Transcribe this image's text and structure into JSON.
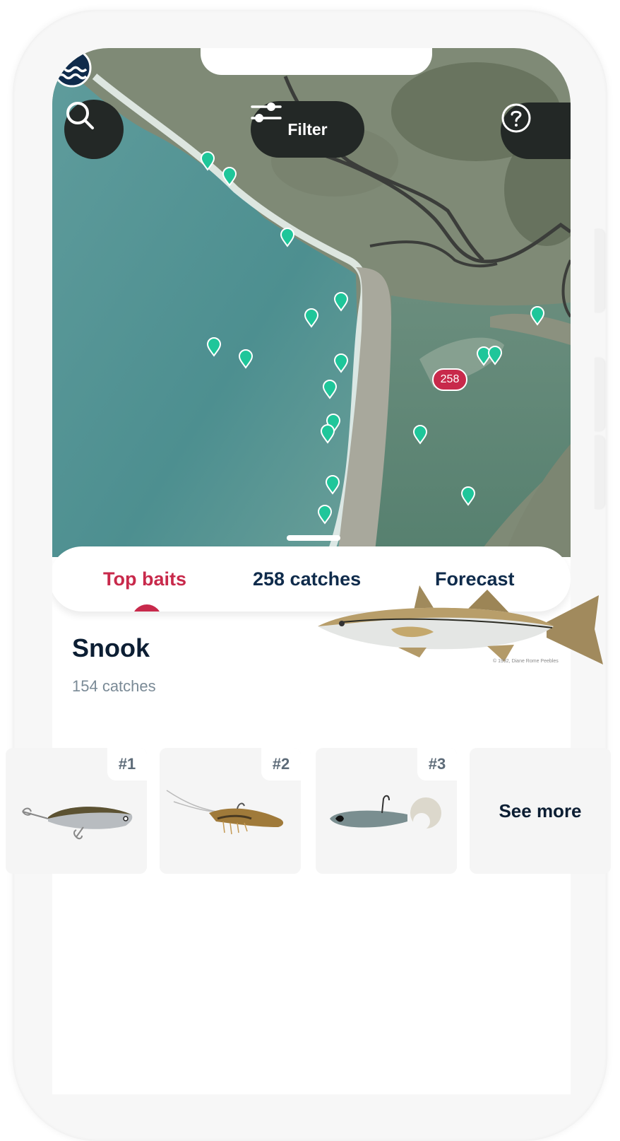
{
  "map": {
    "search_button_icon": "search-icon",
    "filter_button": {
      "label": "Filter",
      "icon": "sliders-icon"
    },
    "help_button_icon": "help-circle-icon",
    "cluster": {
      "icon": "water-waves-icon",
      "count": "258"
    },
    "pin_color": "#1fc69a"
  },
  "tabs": [
    {
      "label": "Top baits",
      "active": true
    },
    {
      "label": "258 catches",
      "active": false
    },
    {
      "label": "Forecast",
      "active": false
    }
  ],
  "species": {
    "name": "Snook",
    "catches": "154 catches",
    "image_credit": "© 1992, Diane Rome Peebles"
  },
  "baits": [
    {
      "rank": "#1",
      "image": "minnow-lure"
    },
    {
      "rank": "#2",
      "image": "shrimp-lure"
    },
    {
      "rank": "#3",
      "image": "swimbait-grub-lure"
    }
  ],
  "see_more_label": "See more",
  "colors": {
    "accent_red": "#c8294b",
    "navy": "#0f2b4b",
    "pin_green": "#1fc69a",
    "button_dark": "#232826"
  }
}
